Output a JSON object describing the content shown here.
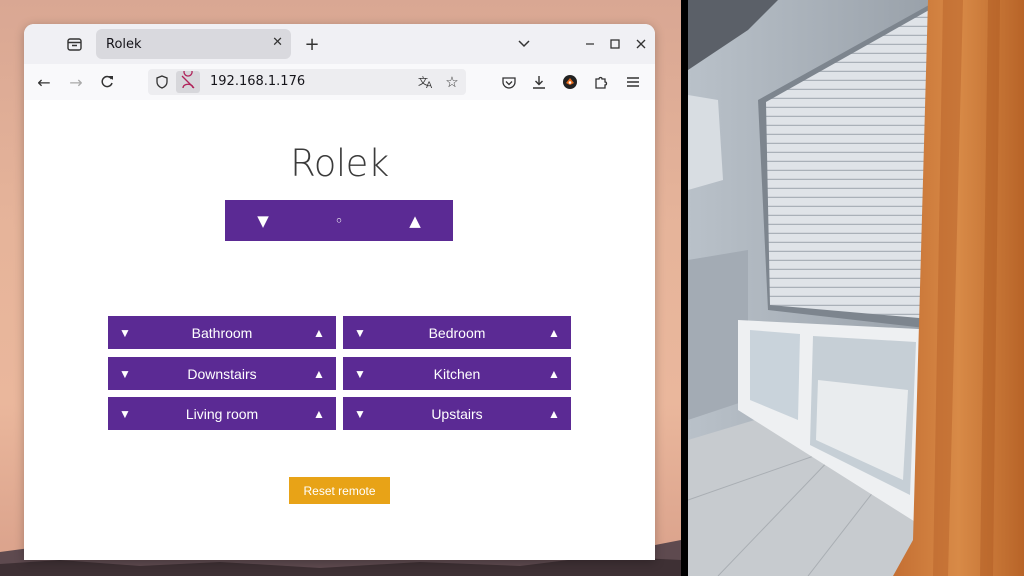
{
  "browser": {
    "tab_title": "Rolek",
    "url": "192.168.1.176"
  },
  "page": {
    "title": "Rolek",
    "master": {
      "down": "▼",
      "stop": "◦",
      "up": "▲"
    },
    "rooms": [
      {
        "label": "Bathroom",
        "down": "▼",
        "up": "▲"
      },
      {
        "label": "Bedroom",
        "down": "▼",
        "up": "▲"
      },
      {
        "label": "Downstairs",
        "down": "▼",
        "up": "▲"
      },
      {
        "label": "Kitchen",
        "down": "▼",
        "up": "▲"
      },
      {
        "label": "Living room",
        "down": "▼",
        "up": "▲"
      },
      {
        "label": "Upstairs",
        "down": "▼",
        "up": "▲"
      }
    ],
    "reset_label": "Reset remote"
  },
  "icons": {
    "tab_overview": "tab-overview-icon",
    "new_tab": "+",
    "list_tabs": "chevron-down-icon",
    "minimize": "minimize-icon",
    "maximize": "maximize-icon",
    "close": "close-icon",
    "back": "←",
    "forward": "→",
    "reload": "reload-icon",
    "menu": "hamburger-icon"
  },
  "colors": {
    "button_purple": "#5b2a94",
    "reset_orange": "#e8a317"
  }
}
